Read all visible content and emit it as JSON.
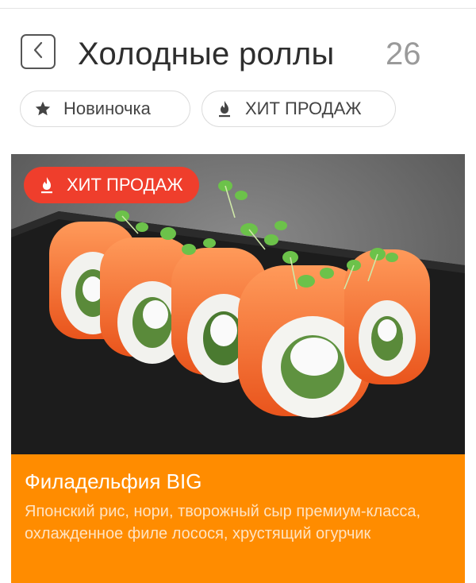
{
  "header": {
    "title": "Холодные роллы",
    "count": "26"
  },
  "filters": [
    {
      "label": "Новиночка",
      "icon": "star-icon"
    },
    {
      "label": "ХИТ ПРОДАЖ",
      "icon": "fire-icon"
    }
  ],
  "product": {
    "badge": "ХИТ ПРОДАЖ",
    "badge_icon": "fire-icon",
    "name": "Филадельфия BIG",
    "description": "Японский рис, нори, творожный сыр премиум-класса, охлажденное филе лосося, хрустящий огурчик"
  },
  "colors": {
    "accent": "#ff8c00",
    "badge": "#ef3e2c",
    "title": "#2e2e2e",
    "count": "#9a9a9a"
  }
}
